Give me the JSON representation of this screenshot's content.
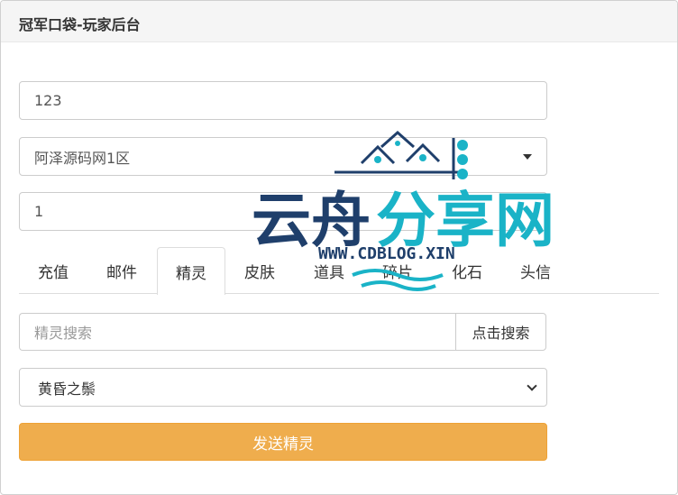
{
  "header": {
    "title": "冠军口袋-玩家后台"
  },
  "form": {
    "account_value": "123",
    "server_value": "阿泽源码网1区",
    "quantity_value": "1"
  },
  "tabs": [
    {
      "label": "充值"
    },
    {
      "label": "邮件"
    },
    {
      "label": "精灵",
      "active": true
    },
    {
      "label": "皮肤"
    },
    {
      "label": "道具"
    },
    {
      "label": "碎片"
    },
    {
      "label": "化石"
    },
    {
      "label": "头信"
    }
  ],
  "sprite_panel": {
    "search_placeholder": "精灵搜索",
    "search_button": "点击搜索",
    "selected_sprite": "黄昏之鬃",
    "send_button": "发送精灵"
  },
  "watermark": {
    "brand_left": "云舟",
    "brand_right": "分享网",
    "url": "WWW.CDBLOG.XIN",
    "primary_color": "#1f3f6b",
    "accent_color": "#1ab3c7"
  },
  "colors": {
    "send_button": "#efad4d"
  }
}
